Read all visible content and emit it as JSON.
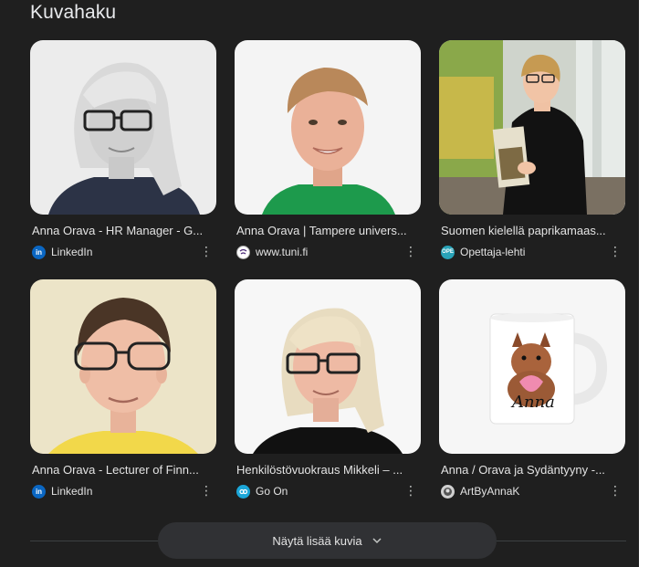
{
  "section": {
    "title": "Kuvahaku"
  },
  "results": [
    {
      "caption": "Anna Orava - HR Manager - G...",
      "source": "LinkedIn",
      "favicon": "linkedin-icon",
      "favicon_text": "in",
      "favicon_color": "#0a66c2"
    },
    {
      "caption": "Anna Orava | Tampere univers...",
      "source": "www.tuni.fi",
      "favicon": "tuni-icon",
      "favicon_text": "",
      "favicon_color": "#ffffff"
    },
    {
      "caption": "Suomen kielellä paprikamaas...",
      "source": "Opettaja-lehti",
      "favicon": "ope-icon",
      "favicon_text": "OPE",
      "favicon_color": "#29a3b8"
    },
    {
      "caption": "Anna Orava - Lecturer of Finn...",
      "source": "LinkedIn",
      "favicon": "linkedin-icon",
      "favicon_text": "in",
      "favicon_color": "#0a66c2"
    },
    {
      "caption": "Henkilöstövuokraus Mikkeli – ...",
      "source": "Go On",
      "favicon": "goon-icon",
      "favicon_text": "",
      "favicon_color": "#1ba6d8"
    },
    {
      "caption": "Anna / Orava ja Sydäntyyny -...",
      "source": "ArtByAnnaK",
      "favicon": "artbyannak-icon",
      "favicon_text": "",
      "favicon_color": "#d0d0d0"
    }
  ],
  "mug_text": "Anna",
  "more_button": {
    "label": "Näytä lisää kuvia"
  },
  "colors": {
    "background": "#1f1f1f",
    "button_bg": "#303134",
    "text": "#e3e3e3"
  }
}
